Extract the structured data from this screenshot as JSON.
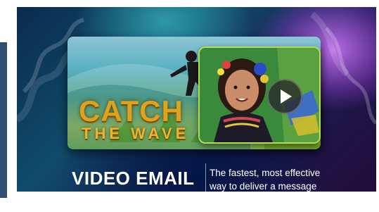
{
  "banner": {
    "headline_line1": "CATCH",
    "headline_line2": "THE WAVE",
    "brand": "VIDEO EMAIL",
    "tagline": "The fastest, most effective way to deliver a message",
    "video": {
      "play_icon": "play-icon"
    }
  },
  "colors": {
    "headline": "#e0a21a",
    "brand_text": "#ffffff",
    "left_panel": "#2f4f73"
  }
}
